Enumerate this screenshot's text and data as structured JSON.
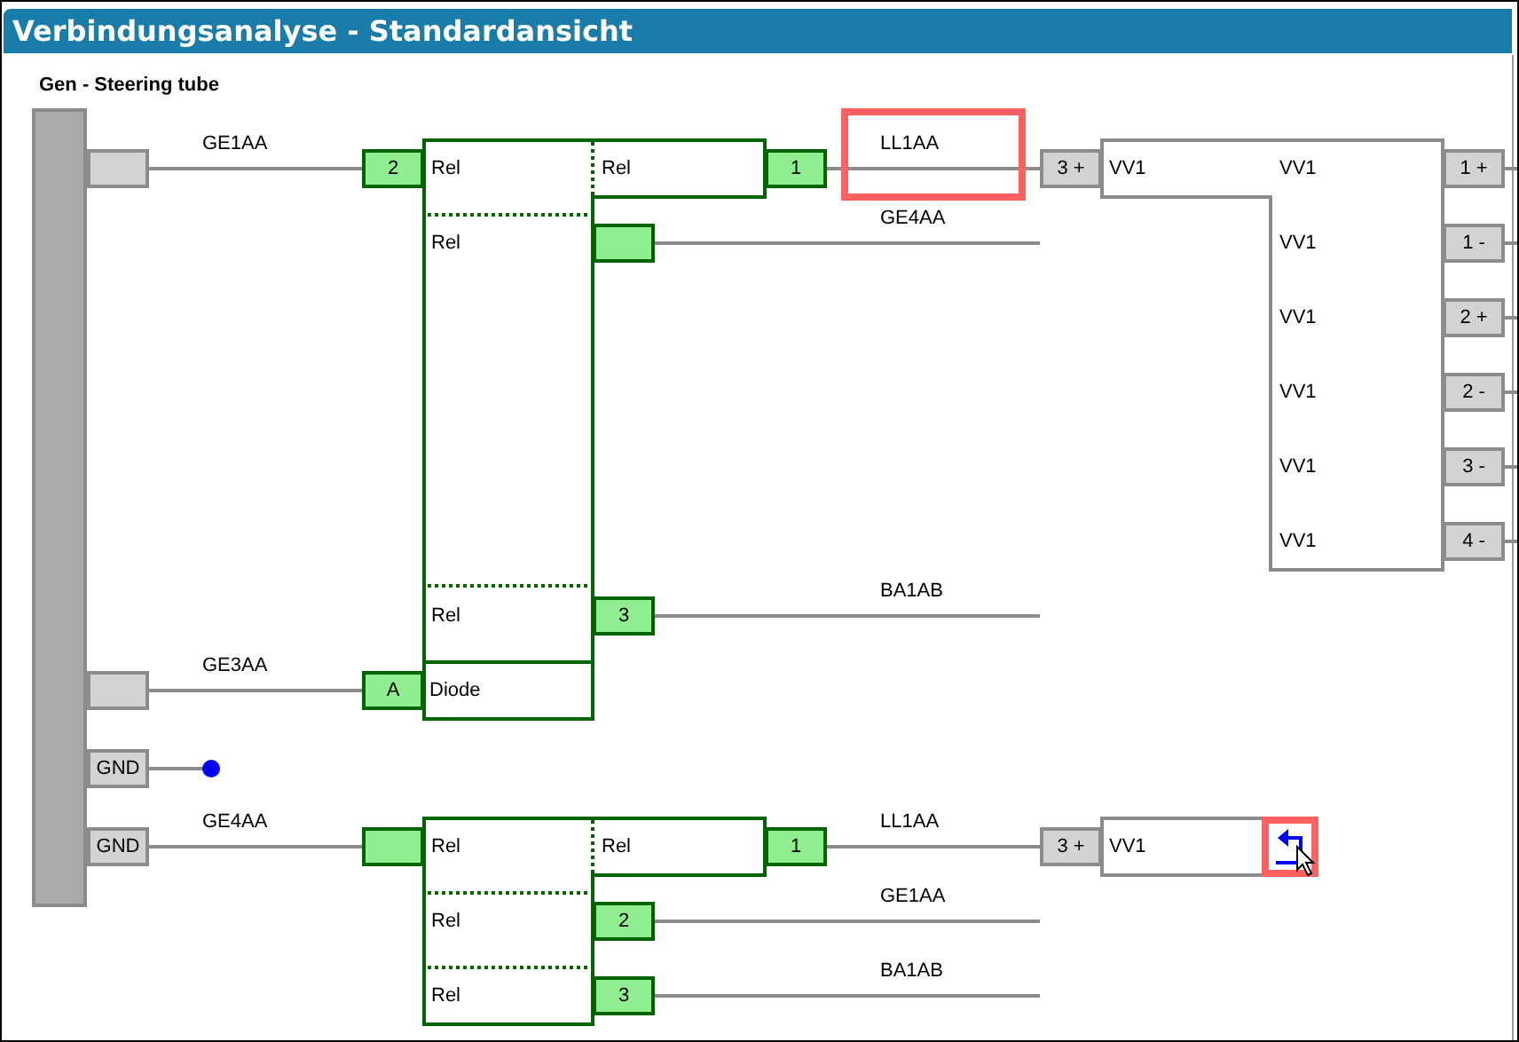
{
  "window": {
    "title": "Verbindungsanalyse - Standardansicht"
  },
  "device": {
    "label": "Gen - Steering tube"
  },
  "pins": [
    {
      "kind": "terminal"
    },
    {
      "kind": "terminal"
    },
    {
      "kind": "terminal",
      "label": "GND"
    },
    {
      "kind": "terminal",
      "label": "GND"
    },
    {
      "kind": "relay",
      "label": "2"
    },
    {
      "kind": "relay",
      "label": "1"
    },
    {
      "kind": "relay"
    },
    {
      "kind": "relay",
      "label": "3"
    },
    {
      "kind": "relay",
      "label": "A"
    },
    {
      "kind": "relay"
    },
    {
      "kind": "relay",
      "label": "1"
    },
    {
      "kind": "relay",
      "label": "2"
    },
    {
      "kind": "relay",
      "label": "3"
    },
    {
      "kind": "terminal",
      "label": "3 +"
    },
    {
      "kind": "terminal",
      "label": "1 +"
    },
    {
      "kind": "terminal",
      "label": "1 -"
    },
    {
      "kind": "terminal",
      "label": "2 +"
    },
    {
      "kind": "terminal",
      "label": "2 -"
    },
    {
      "kind": "terminal",
      "label": "3 -"
    },
    {
      "kind": "terminal",
      "label": "4 -"
    },
    {
      "kind": "terminal",
      "label": "3 +"
    }
  ],
  "wires": [
    {
      "label": "GE1AA",
      "highlighted": false
    },
    {
      "label": "LL1AA",
      "highlighted": true
    },
    {
      "label": "GE4AA",
      "highlighted": false
    },
    {
      "label": "BA1AB",
      "highlighted": false
    },
    {
      "label": "GE3AA",
      "highlighted": false
    },
    {
      "label": "GE4AA",
      "highlighted": false
    },
    {
      "label": "LL1AA",
      "highlighted": false
    },
    {
      "label": "GE1AA",
      "highlighted": false
    },
    {
      "label": "BA1AB",
      "highlighted": false
    }
  ],
  "relay_blocks": [
    {
      "rows": [
        "Rel",
        "Rel",
        "Rel"
      ],
      "contact": "Rel"
    },
    {
      "rows": [
        "Rel",
        "Rel",
        "Rel"
      ],
      "contact": "Rel"
    }
  ],
  "diode": {
    "label": "Diode"
  },
  "connector_blocks": [
    {
      "label": "VV1",
      "rows": [
        "VV1",
        "VV1",
        "VV1",
        "VV1",
        "VV1",
        "VV1"
      ]
    },
    {
      "label": "VV1"
    }
  ],
  "jump_button": {
    "highlighted": true
  }
}
